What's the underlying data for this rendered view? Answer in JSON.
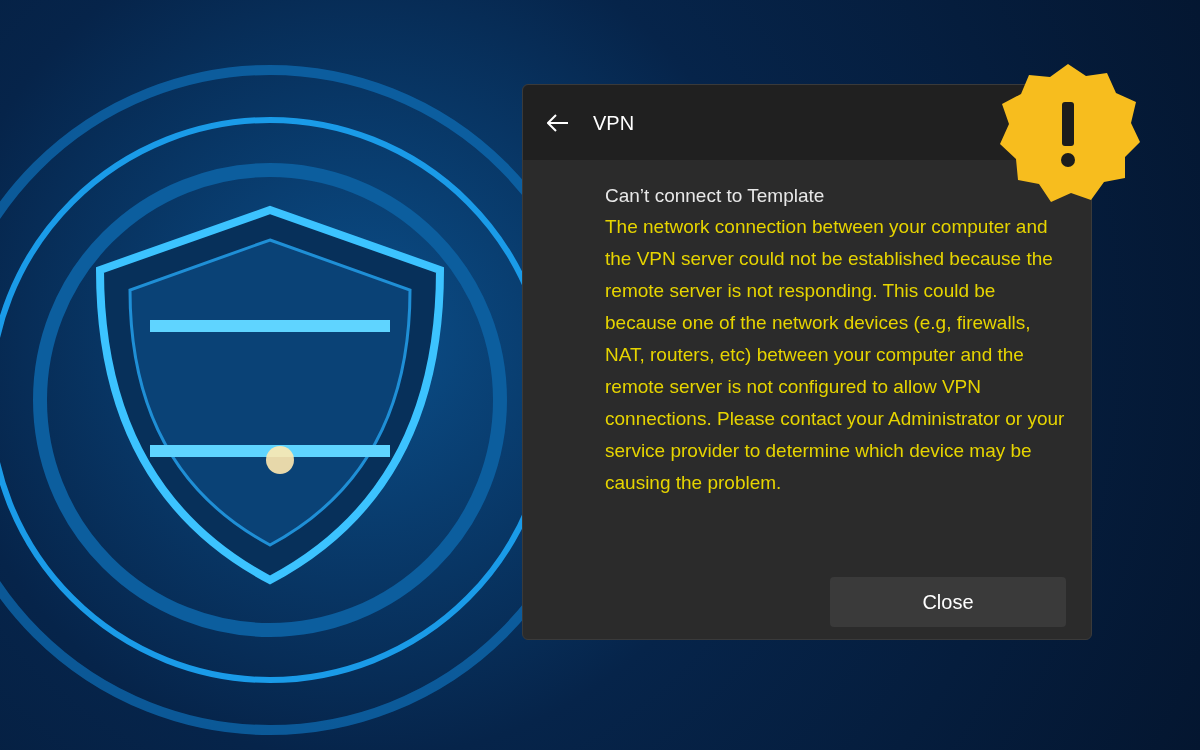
{
  "dialog": {
    "title": "VPN",
    "error_title": "Can’t connect to Template",
    "message": "The network connection between your computer and the VPN server could not be established because the remote server is not responding. This could be because one of the network devices (e.g, firewalls, NAT, routers, etc) between your computer and the remote server is not configured to allow VPN connections. Please contact your Administrator or your service provider to determine which device may be causing the problem.",
    "close_button": "Close"
  }
}
